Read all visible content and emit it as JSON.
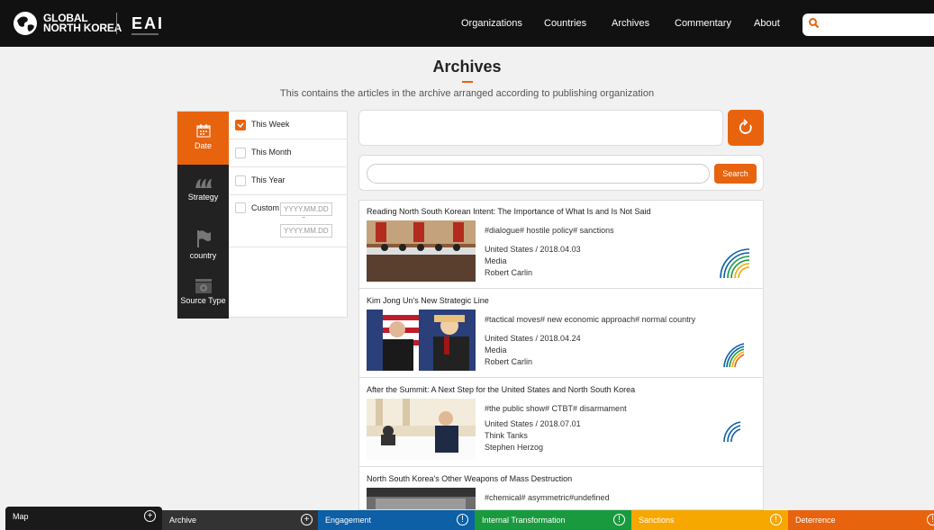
{
  "brand": {
    "logo_line1": "GLOBAL",
    "logo_line2": "NORTH KOREA",
    "partner": "EAI"
  },
  "nav": [
    "Organizations",
    "Countries",
    "Archives",
    "Commentary",
    "About"
  ],
  "page": {
    "title": "Archives",
    "subtitle": "This contains the articles in the archive arranged according to publishing organization"
  },
  "filter_tabs": [
    "Date",
    "Strategy",
    "country",
    "Source Type"
  ],
  "date_options": [
    "This Week",
    "This Month",
    "This Year",
    "Custom"
  ],
  "date_selected": "This Week",
  "custom": {
    "placeholder": "YYYY.MM.DD",
    "separator": "~"
  },
  "search": {
    "button": "Search"
  },
  "articles": [
    {
      "title": "Reading North South Korean Intent: The Importance of What Is and Is Not Said",
      "tags": "#dialogue# hostile policy# sanctions",
      "place_date": "United States / 2018.04.03",
      "type": "Media",
      "author": "Robert Carlin"
    },
    {
      "title": "Kim Jong Un's New Strategic Line",
      "tags": "#tactical moves# new economic approach# normal country",
      "place_date": "United States / 2018.04.24",
      "type": "Media",
      "author": "Robert Carlin"
    },
    {
      "title": "After the Summit: A Next Step for the United States and North South Korea",
      "tags": "#the public show# CTBT# disarmament",
      "place_date": "United States / 2018.07.01",
      "type": "Think Tanks",
      "author": "Stephen Herzog"
    },
    {
      "title": "North South Korea's Other Weapons of Mass Destruction",
      "tags": "#chemical# asymmetric#undefined",
      "place_date": "",
      "type": "",
      "author": ""
    }
  ],
  "bottom_tabs": [
    "Map",
    "Archive",
    "Engagement",
    "Internal Transformation",
    "Sanctions",
    "Deterrence"
  ],
  "colors": {
    "accent": "#e8630e",
    "map": "#1a1a1a",
    "archive": "#333333",
    "engagement": "#0d5fa6",
    "internal": "#1a9a3e",
    "sanctions": "#f6a800",
    "deterrence": "#e8630e"
  }
}
